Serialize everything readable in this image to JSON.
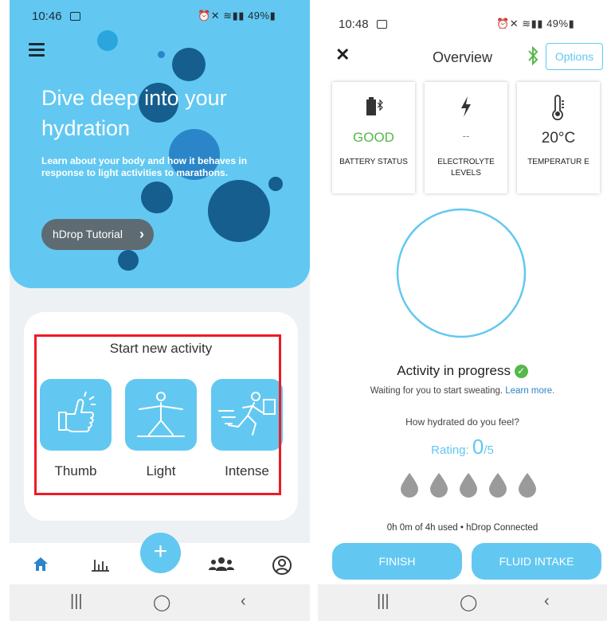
{
  "phone1": {
    "status": {
      "time": "10:46",
      "battery": "49%"
    },
    "hero": {
      "title": "Dive deep into your hydration",
      "subtitle": "Learn about your body and how it behaves in response to light activities to marathons.",
      "button": "hDrop Tutorial"
    },
    "card_title": "Start new activity",
    "activities": [
      {
        "label": "Thumb",
        "icon": "thumbs-up-icon"
      },
      {
        "label": "Light",
        "icon": "yoga-pose-icon"
      },
      {
        "label": "Intense",
        "icon": "runner-icon"
      }
    ],
    "fab_label": "+",
    "tabs": [
      "home-icon",
      "stats-icon",
      "community-icon",
      "profile-icon"
    ],
    "accent": "#62c8f1"
  },
  "phone2": {
    "status": {
      "time": "10:48",
      "battery": "49%"
    },
    "title": "Overview",
    "options": "Options",
    "stats": [
      {
        "value": "GOOD",
        "label": "BATTERY STATUS",
        "icon": "battery-bluetooth-icon",
        "color": "#55b84a"
      },
      {
        "value": "--",
        "label": "ELECTROLYTE LEVELS",
        "icon": "lightning-icon",
        "color": "#888888"
      },
      {
        "value": "20°C",
        "label": "TEMPERATUR E",
        "icon": "thermometer-icon",
        "color": "#333333"
      }
    ],
    "progress_title": "Activity in progress",
    "waiting_text": "Waiting for you to start sweating.",
    "learn_more": "Learn more.",
    "feel_question": "How hydrated do you feel?",
    "rating_label": "Rating:",
    "rating_value": "0",
    "rating_max": "/5",
    "drop_count": 5,
    "usage": "0h 0m of 4h used",
    "connection": "hDrop Connected",
    "finish": "FINISH",
    "fluid": "FLUID INTAKE"
  }
}
